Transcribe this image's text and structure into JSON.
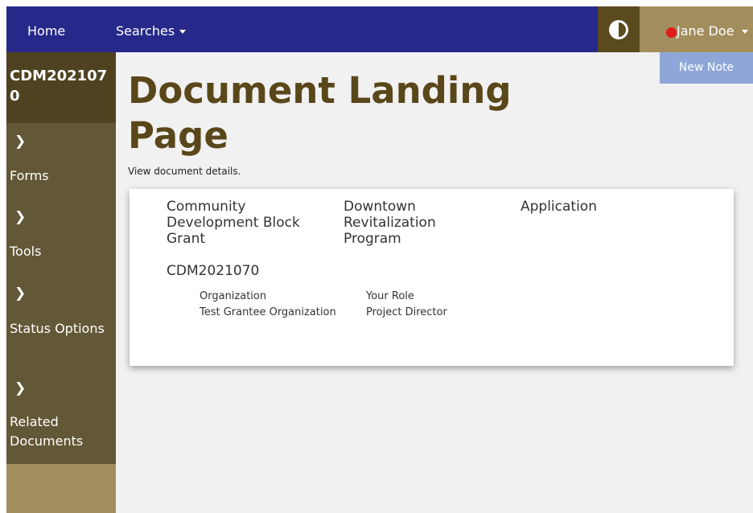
{
  "nav": {
    "home": "Home",
    "searches": "Searches",
    "user": {
      "name": "Jane Doe",
      "status_color": "#e21b1b"
    },
    "contrast_icon": "contrast-icon"
  },
  "sidebar": {
    "doc_id": "CDM2021070",
    "items": [
      {
        "label": "Forms",
        "icon": "chevron-right-icon"
      },
      {
        "label": "Tools",
        "icon": "chevron-right-icon"
      },
      {
        "label": "Status Options",
        "icon": "chevron-right-icon"
      },
      {
        "label": "Related Documents",
        "icon": "chevron-right-icon"
      }
    ]
  },
  "main": {
    "new_note": "New Note",
    "title": "Document Landing Page",
    "subtitle": "View document details.",
    "card": {
      "categories": [
        "Community Development Block Grant",
        "Downtown Revitalization Program",
        "Application"
      ],
      "doc_id": "CDM2021070",
      "fields": [
        {
          "label": "Organization",
          "value": "Test Grantee Organization"
        },
        {
          "label": "Your Role",
          "value": "Project Director"
        }
      ]
    }
  },
  "colors": {
    "nav_bg": "#27298a",
    "sidebar_bg": "#625837",
    "sidebar_head_bg": "#4f4220",
    "accent_gold": "#a28e5d",
    "title_color": "#5a4719",
    "new_note_bg": "#8ea7d8"
  }
}
